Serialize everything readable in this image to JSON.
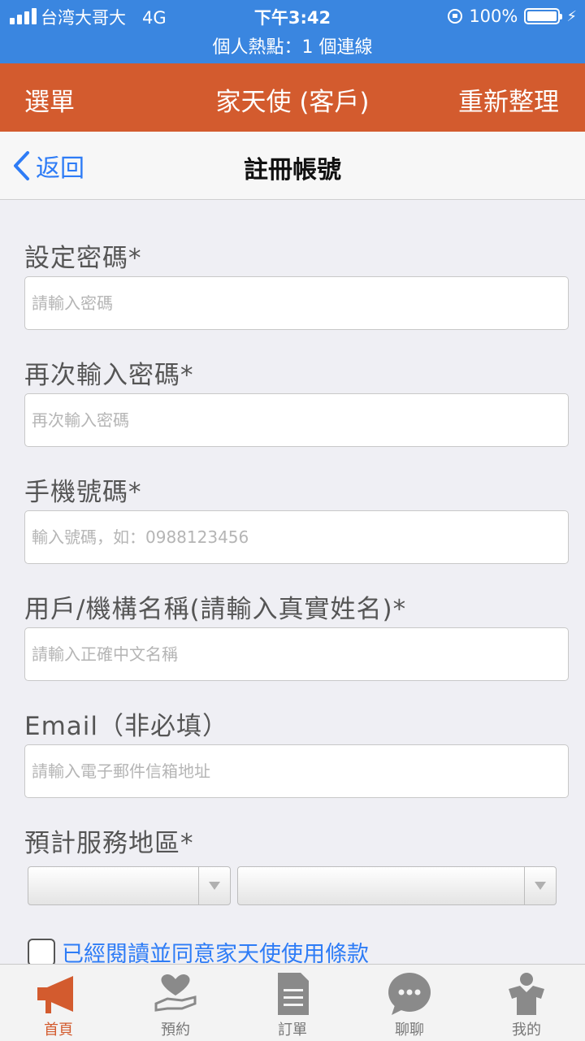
{
  "status_bar": {
    "carrier": "台湾大哥大",
    "network": "4G",
    "time": "下午3:42",
    "battery": "100%",
    "hotspot": "個人熱點：1 個連線"
  },
  "app_bar": {
    "menu_label": "選單",
    "title": "家天使 (客戶)",
    "refresh_label": "重新整理",
    "color": "#d35b2e"
  },
  "nav_bar": {
    "back_label": "返回",
    "title": "註冊帳號"
  },
  "form": {
    "password": {
      "label": "設定密碼*",
      "placeholder": "請輸入密碼",
      "value": ""
    },
    "password_confirm": {
      "label": "再次輸入密碼*",
      "placeholder": "再次輸入密碼",
      "value": ""
    },
    "phone": {
      "label": "手機號碼*",
      "placeholder": "輸入號碼，如：0988123456",
      "value": ""
    },
    "name": {
      "label": "用戶/機構名稱(請輸入真實姓名)*",
      "placeholder": "請輸入正確中文名稱",
      "value": ""
    },
    "email": {
      "label": "Email（非必填）",
      "placeholder": "請輸入電子郵件信箱地址",
      "value": ""
    },
    "region": {
      "label": "預計服務地區*",
      "city_value": "",
      "district_value": ""
    },
    "terms_label": "已經閱讀並同意家天使使用條款"
  },
  "tabs": [
    {
      "label": "首頁",
      "icon": "megaphone-icon",
      "active": true
    },
    {
      "label": "預約",
      "icon": "heart-hand-icon",
      "active": false
    },
    {
      "label": "訂單",
      "icon": "document-icon",
      "active": false
    },
    {
      "label": "聊聊",
      "icon": "chat-bubble-icon",
      "active": false
    },
    {
      "label": "我的",
      "icon": "user-icon",
      "active": false
    }
  ],
  "colors": {
    "accent": "#d35b2e",
    "link": "#2e7cf6",
    "status_bar": "#3a86e0"
  }
}
